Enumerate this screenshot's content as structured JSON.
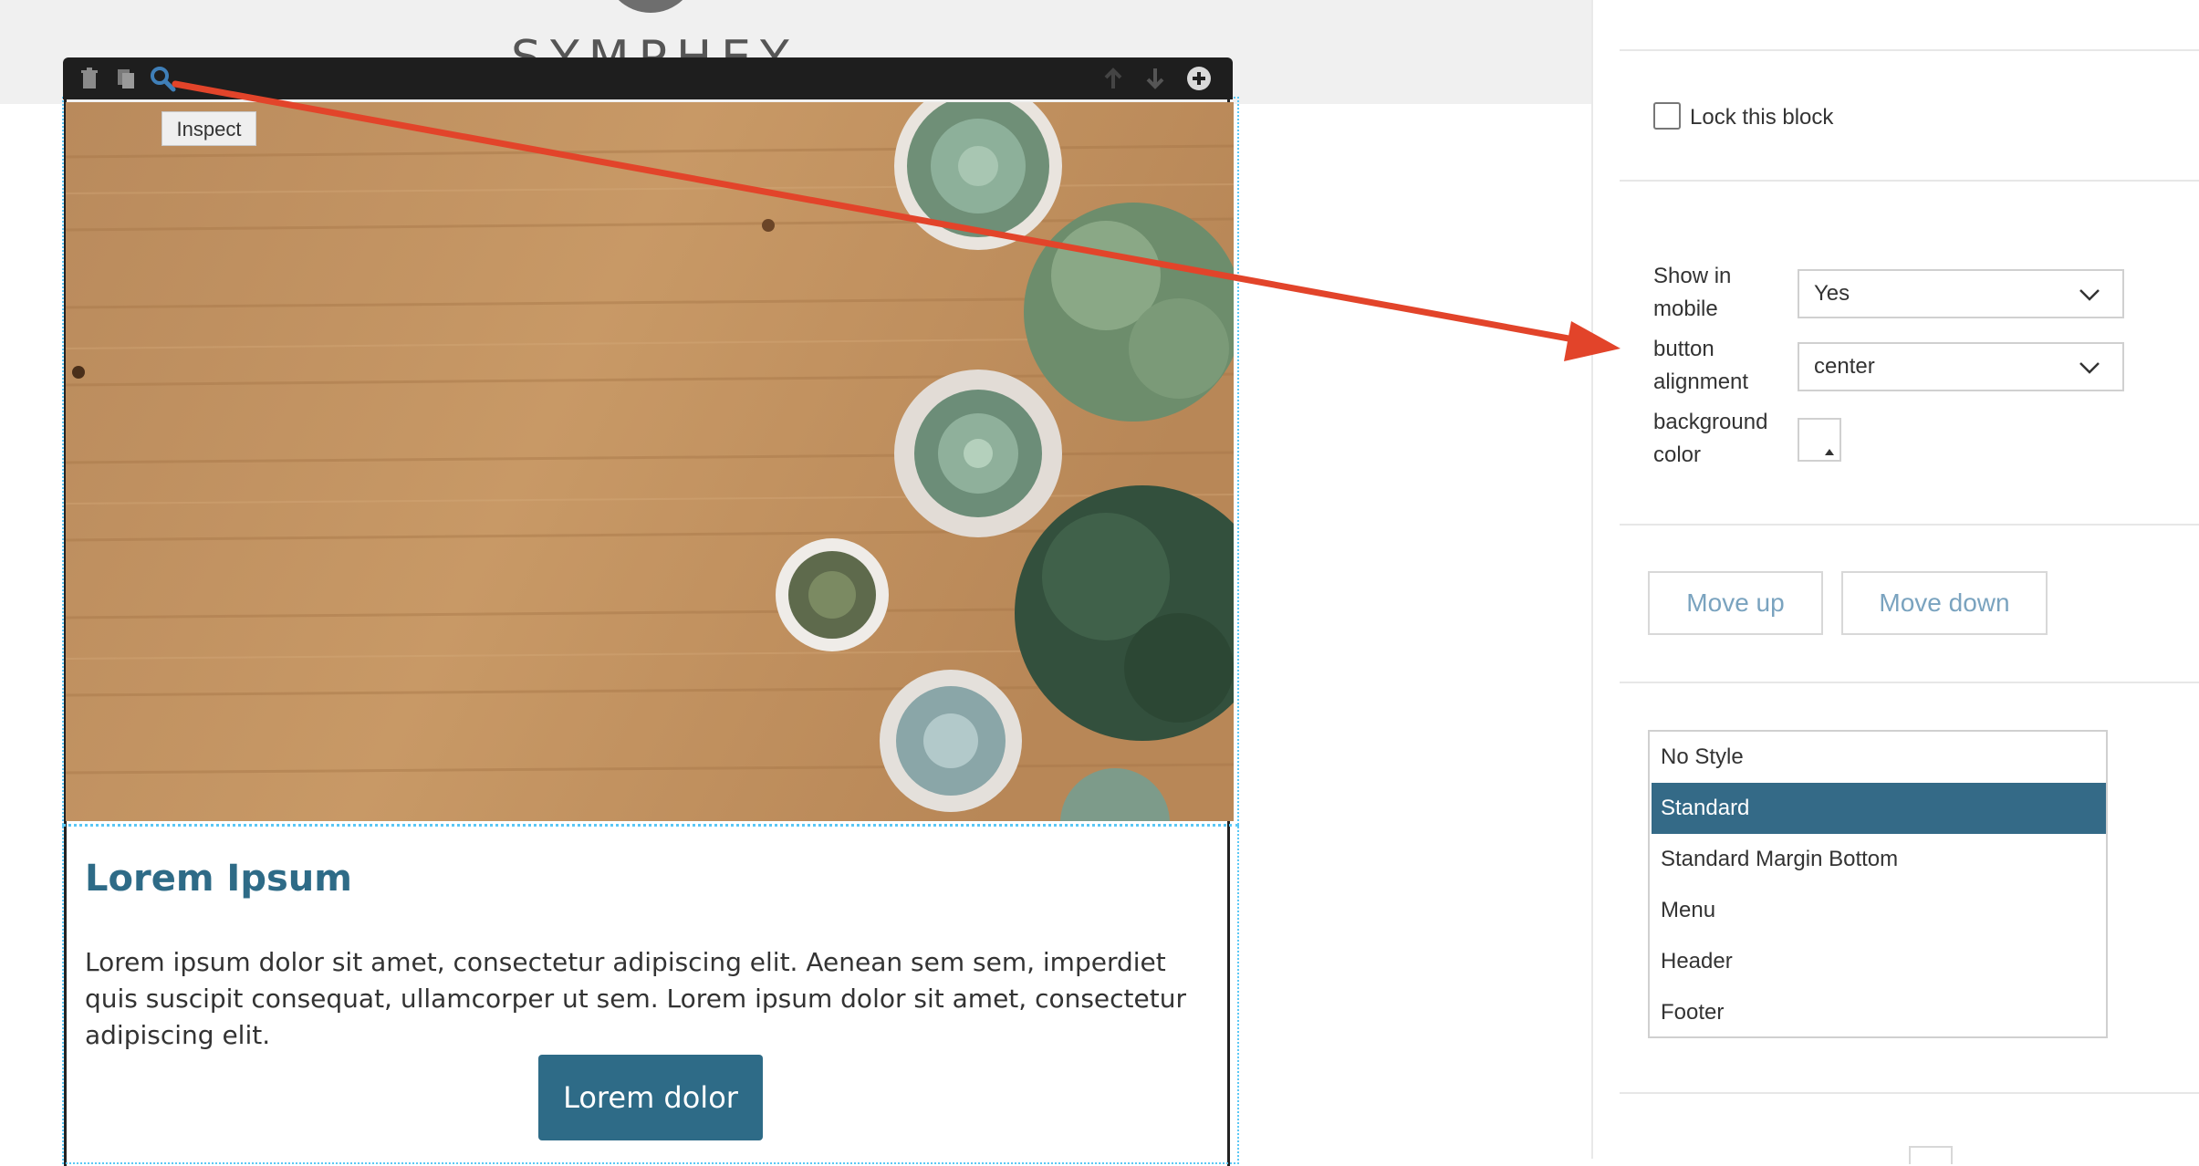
{
  "canvas": {
    "logo_text": "SYMPHEY",
    "tooltip": "Inspect",
    "toolbar": {
      "icons": [
        "trash-icon",
        "copy-icon",
        "search-icon",
        "arrow-up-icon",
        "arrow-down-icon",
        "plus-circle-icon"
      ]
    },
    "content": {
      "title": "Lorem Ipsum",
      "body": "Lorem ipsum dolor sit amet, consectetur adipiscing elit. Aenean sem sem, imperdiet quis suscipit consequat, ullamcorper ut sem. Lorem ipsum dolor sit amet, consectetur adipiscing elit.",
      "button_label": "Lorem dolor"
    }
  },
  "panel": {
    "lock_label": "Lock this block",
    "show_in_mobile": {
      "label_line1": "Show in",
      "label_line2": "mobile",
      "value": "Yes"
    },
    "button_alignment": {
      "label_line1": "button",
      "label_line2": "alignment",
      "value": "center"
    },
    "background_color": {
      "label_line1": "background",
      "label_line2": "color"
    },
    "move_up_label": "Move up",
    "move_down_label": "Move down",
    "styles": [
      {
        "label": "No Style",
        "selected": false
      },
      {
        "label": "Standard",
        "selected": true
      },
      {
        "label": "Standard Margin Bottom",
        "selected": false
      },
      {
        "label": "Menu",
        "selected": false
      },
      {
        "label": "Header",
        "selected": false
      },
      {
        "label": "Footer",
        "selected": false
      }
    ]
  },
  "colors": {
    "accent": "#2e6b87",
    "selected_style": "#346a87",
    "arrow": "#e2442a",
    "outline": "#5bc8f5"
  }
}
